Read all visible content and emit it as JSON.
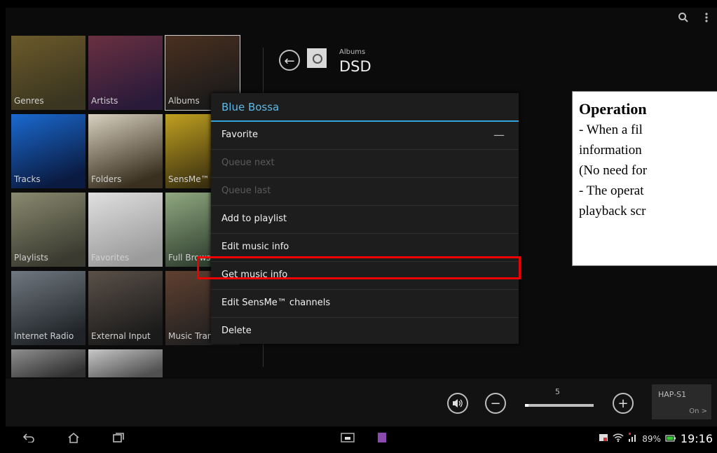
{
  "topbar": {
    "icons": [
      "search-icon",
      "overflow-menu-icon"
    ]
  },
  "categories": [
    {
      "label": "Genres",
      "col": 0,
      "row": 0,
      "colors": [
        "#3a3520",
        "#6b5a2a"
      ]
    },
    {
      "label": "Artists",
      "col": 1,
      "row": 0,
      "colors": [
        "#2a1a3a",
        "#6a3040"
      ]
    },
    {
      "label": "Albums",
      "col": 2,
      "row": 0,
      "colors": [
        "#1a1a1a",
        "#4a3020"
      ],
      "selected": true
    },
    {
      "label": "Tracks",
      "col": 0,
      "row": 1,
      "colors": [
        "#0a1a40",
        "#1a6ad0"
      ]
    },
    {
      "label": "Folders",
      "col": 1,
      "row": 1,
      "colors": [
        "#3a3020",
        "#d8d0c0"
      ]
    },
    {
      "label": "SensMe™ channels",
      "col": 2,
      "row": 1,
      "colors": [
        "#3a3010",
        "#c0a020"
      ]
    },
    {
      "label": "Playlists",
      "col": 0,
      "row": 2,
      "colors": [
        "#3a3a30",
        "#8a8a70"
      ]
    },
    {
      "label": "Favorites",
      "col": 1,
      "row": 2,
      "colors": [
        "#9a9a9a",
        "#e0e0e0"
      ]
    },
    {
      "label": "Full Browse",
      "col": 2,
      "row": 2,
      "colors": [
        "#304030",
        "#90a880"
      ]
    },
    {
      "label": "Internet Radio",
      "col": 0,
      "row": 3,
      "colors": [
        "#202428",
        "#707880"
      ]
    },
    {
      "label": "External Input",
      "col": 1,
      "row": 3,
      "colors": [
        "#1a1a1a",
        "#5a5048"
      ]
    },
    {
      "label": "Music Transfer",
      "col": 2,
      "row": 3,
      "colors": [
        "#202020",
        "#604030"
      ]
    },
    {
      "label": "",
      "col": 0,
      "row": 4,
      "colors": [
        "#303030",
        "#909090"
      ]
    },
    {
      "label": "",
      "col": 1,
      "row": 4,
      "colors": [
        "#505050",
        "#c8c8c8"
      ]
    }
  ],
  "album_header": {
    "category": "Albums",
    "title": "DSD"
  },
  "context_menu": {
    "title": "Blue Bossa",
    "items": [
      {
        "label": "Favorite",
        "disabled": false
      },
      {
        "label": "Queue next",
        "disabled": true
      },
      {
        "label": "Queue last",
        "disabled": true
      },
      {
        "label": "Add to playlist",
        "disabled": false
      },
      {
        "label": "Edit music info",
        "disabled": false
      },
      {
        "label": "Get music info",
        "disabled": false,
        "highlighted": true
      },
      {
        "label": "Edit SensMe™ channels",
        "disabled": false
      },
      {
        "label": "Delete",
        "disabled": false
      }
    ],
    "favorite_indicator": "—"
  },
  "volume": {
    "value": "5",
    "level": 0.05
  },
  "device": {
    "name": "HAP-S1",
    "status": "On >"
  },
  "status_bar": {
    "battery": "89%",
    "time": "19:16"
  },
  "annotation": {
    "title": "Operation",
    "lines": [
      "- When a fil",
      "information",
      "(No need for",
      "- The operat",
      "playback scr"
    ]
  },
  "colors": {
    "accent": "#33a3dc",
    "highlight_border": "#ee0000"
  }
}
